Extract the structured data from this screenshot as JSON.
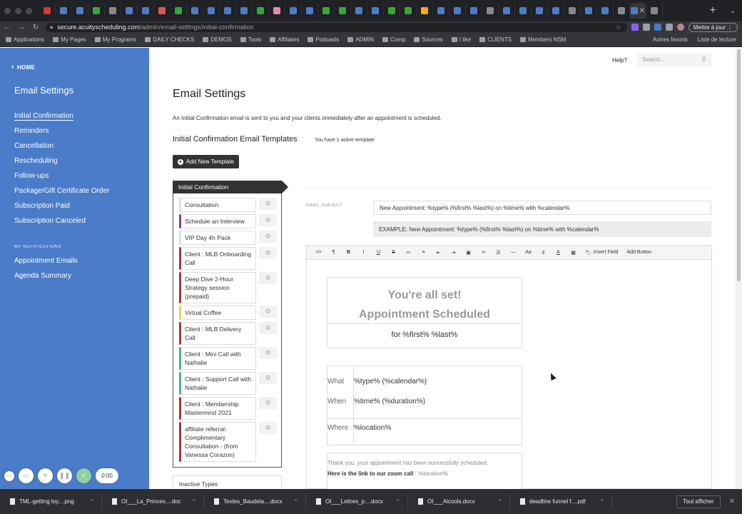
{
  "browser": {
    "url_host": "secure.acuityscheduling.com",
    "url_path": "/admin/email-settings/initial-confirmation",
    "update_label": "Mettre à jour",
    "tab_colors": [
      "#d33",
      "#4a7cc9",
      "#4a7cc9",
      "#3a3",
      "#888",
      "#4a7cc9",
      "#4a7cc9",
      "#d55",
      "#3a3",
      "#4a7cc9",
      "#4a7cc9",
      "#4a7cc9",
      "#4a7cc9",
      "#3a3",
      "#e8a",
      "#4a7cc9",
      "#4a7cc9",
      "#3a3",
      "#3a3",
      "#4a7cc9",
      "#4a7cc9",
      "#3a3",
      "#3a3",
      "#fa0",
      "#4a7cc9",
      "#4a7cc9",
      "#4a7cc9",
      "#888",
      "#4a7cc9",
      "#4a7cc9",
      "#4a7cc9",
      "#4a7cc9",
      "#888",
      "#4a7cc9",
      "#4a7cc9",
      "#888",
      "#4a7cc9",
      "#888"
    ],
    "bookmarks": [
      "Applications",
      "My Pages",
      "My Programs",
      "DAILY CHECKS",
      "DEMOS",
      "Tools",
      "Affiliates",
      "Podcasts",
      "ADMIN",
      "Comp",
      "Sources",
      "I like",
      "CLIENTS",
      "Members NSM"
    ],
    "bookmarks_right": [
      "Autres favoris",
      "Liste de lecture"
    ]
  },
  "sidebar": {
    "home_label": "HOME",
    "title": "Email Settings",
    "nav": [
      "Initial Confirmation",
      "Reminders",
      "Cancellation",
      "Rescheduling",
      "Follow-ups",
      "Package/Gift Certificate Order",
      "Subscription Paid",
      "Subscription Canceled"
    ],
    "notifications_header": "MY NOTIFICATIONS",
    "notifications": [
      "Appointment Emails",
      "Agenda Summary"
    ]
  },
  "header": {
    "help_label": "Help?",
    "search_placeholder": "Search..."
  },
  "main": {
    "title": "Email Settings",
    "description": "An Initial Confirmation email is sent to you and your clients immediately after an appointment is scheduled.",
    "templates_title": "Initial Confirmation Email Templates",
    "templates_count": "You have 1 active template",
    "add_button": "Add New Template",
    "active_template": "Initial Confirmation",
    "template_items": [
      "Consultation",
      "Schedule an Interview",
      "VIP Day 4h Pack",
      "Client : MLB Onboarding Call",
      "Deep Dive 2-Hour Strategy session (prepaid)",
      "Virtual Coffee",
      "Client : MLB Delivery Call",
      "Client : Mini Call with Nathalie",
      "Client : Support Call with Nathalie",
      "Client : Membership Mastermind 2021",
      "affiliate referral: Complimentary Consultation - (from Vanessa Corazon)"
    ],
    "template_colors": [
      "#cfe3f2",
      "#8a3aa0",
      "#cfe3f2",
      "#a33",
      "#a33",
      "#f0d060",
      "#a33",
      "#5a9",
      "#5a9",
      "#a33",
      "#a33"
    ],
    "inactive_label": "Inactive Types",
    "subject_label": "EMAIL SUBJECT",
    "subject_value": "New Appointment: %type% (%first% %last%) on %time% with %calendar%",
    "subject_example": "EXAMPLE: New Appointment: %type% (%first% %last%) on %time% with %calendar%",
    "toolbar_insert_field": "Insert Field",
    "toolbar_add_button": "Add Button",
    "email_heading1": "You're all set!",
    "email_heading2": "Appointment Scheduled",
    "email_for": "for %first% %last%",
    "detail_rows": [
      {
        "label": "What",
        "value": "%type% (%calendar%)"
      },
      {
        "label": "When",
        "value": "%time% (%duration%)"
      },
      {
        "label": "Where",
        "value": "%location%"
      }
    ],
    "thank_you": "Thank you, your appointment has been successfully scheduled.",
    "zoom_prefix": "Here is the link to our zoom call",
    "zoom_value": " : %location%"
  },
  "recording": {
    "timer": "0:00"
  },
  "downloads": {
    "items": [
      "TML-getting loy....png",
      "OI___La_Princes....doc",
      "Textes_Baudela....docx",
      "OI___Lettres_p....docx",
      "OI___Alcools.docx",
      "deadline funnel f....pdf"
    ],
    "show_all": "Tout afficher"
  }
}
